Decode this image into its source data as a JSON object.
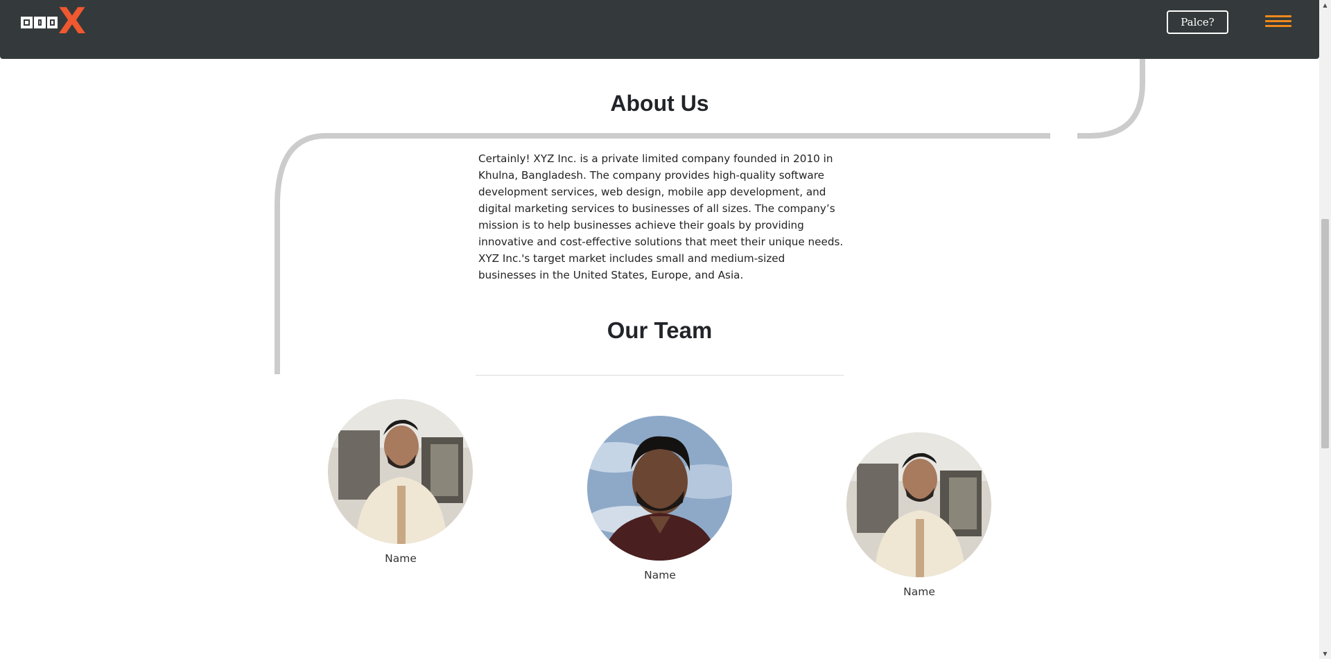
{
  "navbar": {
    "brand_text": "DIGIX",
    "brand_letters": [
      "D",
      "I",
      "G",
      "I"
    ],
    "brand_accent_letter": "X",
    "place_button_label": "Palce?",
    "menu_icon": "hamburger-menu-icon",
    "colors": {
      "background": "#343a3b",
      "brand_accent": "#f0582f",
      "menu_accent": "#f08a1c"
    }
  },
  "about": {
    "title": "About Us",
    "text": "Certainly! XYZ Inc. is a private limited company founded in 2010 in Khulna, Bangladesh. The company provides high-quality software development services, web design, mobile app development, and digital marketing services to businesses of all sizes. The company’s mission is to help businesses achieve their goals by providing innovative and cost-effective solutions that meet their unique needs. XYZ Inc.'s target market includes small and medium-sized businesses in the United States, Europe, and Asia."
  },
  "team": {
    "title": "Our Team",
    "members": [
      {
        "name": "Name"
      },
      {
        "name": "Name"
      },
      {
        "name": "Name"
      }
    ]
  }
}
